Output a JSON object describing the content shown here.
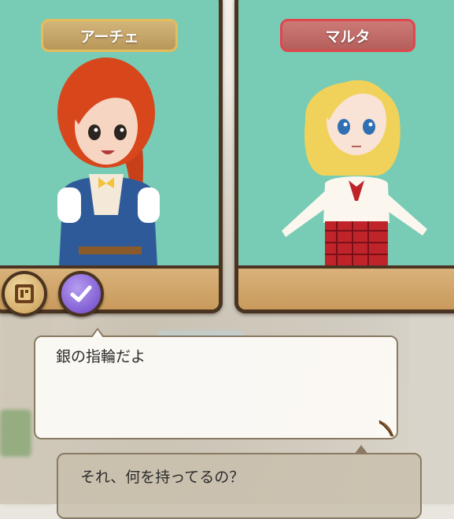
{
  "characters": {
    "left": {
      "name": "アーチェ",
      "plate_color": "#d2b57b",
      "hair_color": "#d8461c",
      "outfit_color": "#2f5a9a"
    },
    "right": {
      "name": "マルタ",
      "plate_color": "#cc7a76",
      "hair_color": "#f0d25a",
      "outfit_color": "#c0242b"
    }
  },
  "panel_bg_color": "#78cbb4",
  "buttons": {
    "book_icon": "book-icon",
    "check_icon": "check-icon"
  },
  "dialog": {
    "speaker_line": "銀の指輪だよ",
    "reply_line": "それ、何を持ってるの？"
  }
}
